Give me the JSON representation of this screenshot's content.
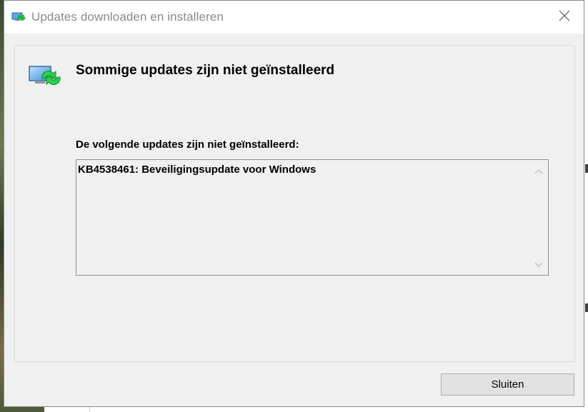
{
  "window": {
    "title": "Updates downloaden en installeren",
    "title_icon": "windows-update-icon",
    "close_icon": "close-icon"
  },
  "dialog": {
    "heading": "Sommige updates zijn niet geïnstalleerd",
    "heading_icon": "windows-update-icon",
    "list_label": "De volgende updates zijn niet geïnstalleerd:",
    "updates": [
      "KB4538461: Beveiligingsupdate voor Windows"
    ],
    "close_button_label": "Sluiten"
  },
  "colors": {
    "titlebar": "#ffffff",
    "client_background": "#f0f0f0",
    "title_text": "#8a8a8a",
    "button_background": "#e1e1e1",
    "icon_green": "#2bd14a",
    "icon_monitor": "#5aa9e6"
  }
}
